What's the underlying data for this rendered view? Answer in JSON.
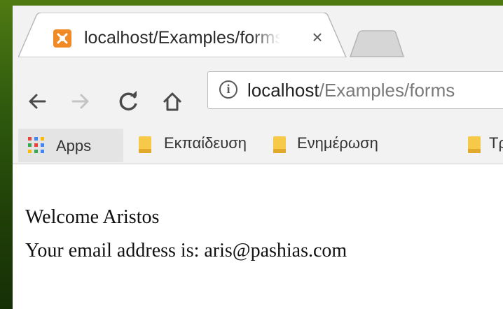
{
  "tab": {
    "title": "localhost/Examples/forms/welcome.php",
    "close_glyph": "×",
    "favicon": "xampp-icon"
  },
  "toolbar": {
    "back": "back-arrow-icon",
    "forward": "forward-arrow-icon",
    "reload": "reload-icon",
    "home": "home-icon"
  },
  "omnibox": {
    "info_glyph": "i",
    "url_host": "localhost",
    "url_path": "/Examples/forms"
  },
  "bookmarks": {
    "items": [
      {
        "label": "Apps",
        "icon": "apps-grid-icon"
      },
      {
        "label": "Εκπαίδευση",
        "icon": "folder-icon"
      },
      {
        "label": "Ενημέρωση",
        "icon": "folder-icon"
      },
      {
        "label": "Τρ",
        "icon": "folder-icon"
      }
    ]
  },
  "content": {
    "line1": "Welcome Aristos",
    "line2": "Your email address is: aris@pashias.com"
  },
  "colors": {
    "background_green": "#2f5a0e",
    "favicon_orange": "#f08a24",
    "folder_yellow": "#f7c948"
  }
}
